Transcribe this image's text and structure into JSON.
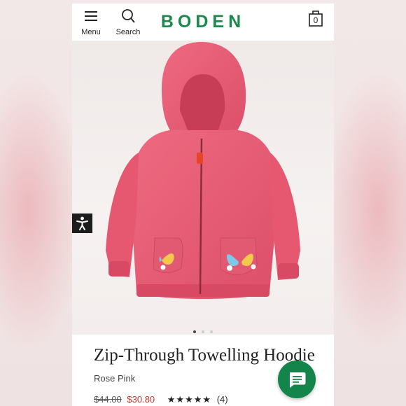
{
  "header": {
    "menu_label": "Menu",
    "search_label": "Search",
    "brand": "BODEN",
    "bag_count": "0"
  },
  "carousel": {
    "total": 3,
    "active_index": 0
  },
  "product": {
    "title": "Zip-Through Towelling Hoodie",
    "colour": "Rose Pink",
    "original_price": "$44.00",
    "sale_price": "$30.80",
    "stars": "★★★★★",
    "review_count": "(4)"
  },
  "colors": {
    "brand_green": "#1a8a4a",
    "sale_red": "#c0392b",
    "hoodie_pink": "#e85a73"
  }
}
